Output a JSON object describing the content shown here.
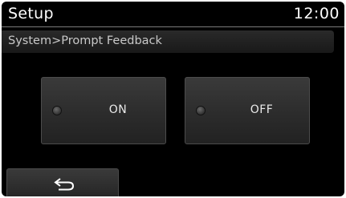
{
  "header": {
    "title": "Setup",
    "clock": "12:00"
  },
  "breadcrumb": {
    "text": "System>Prompt Feedback"
  },
  "options": [
    {
      "label": "ON",
      "selected": false
    },
    {
      "label": "OFF",
      "selected": false
    }
  ],
  "footer": {
    "back_icon": "return-arrow-icon"
  },
  "colors": {
    "background": "#000000",
    "text": "#ffffff",
    "button_face": "#2c2c2c",
    "indicator_off": "#3a3a3a"
  }
}
